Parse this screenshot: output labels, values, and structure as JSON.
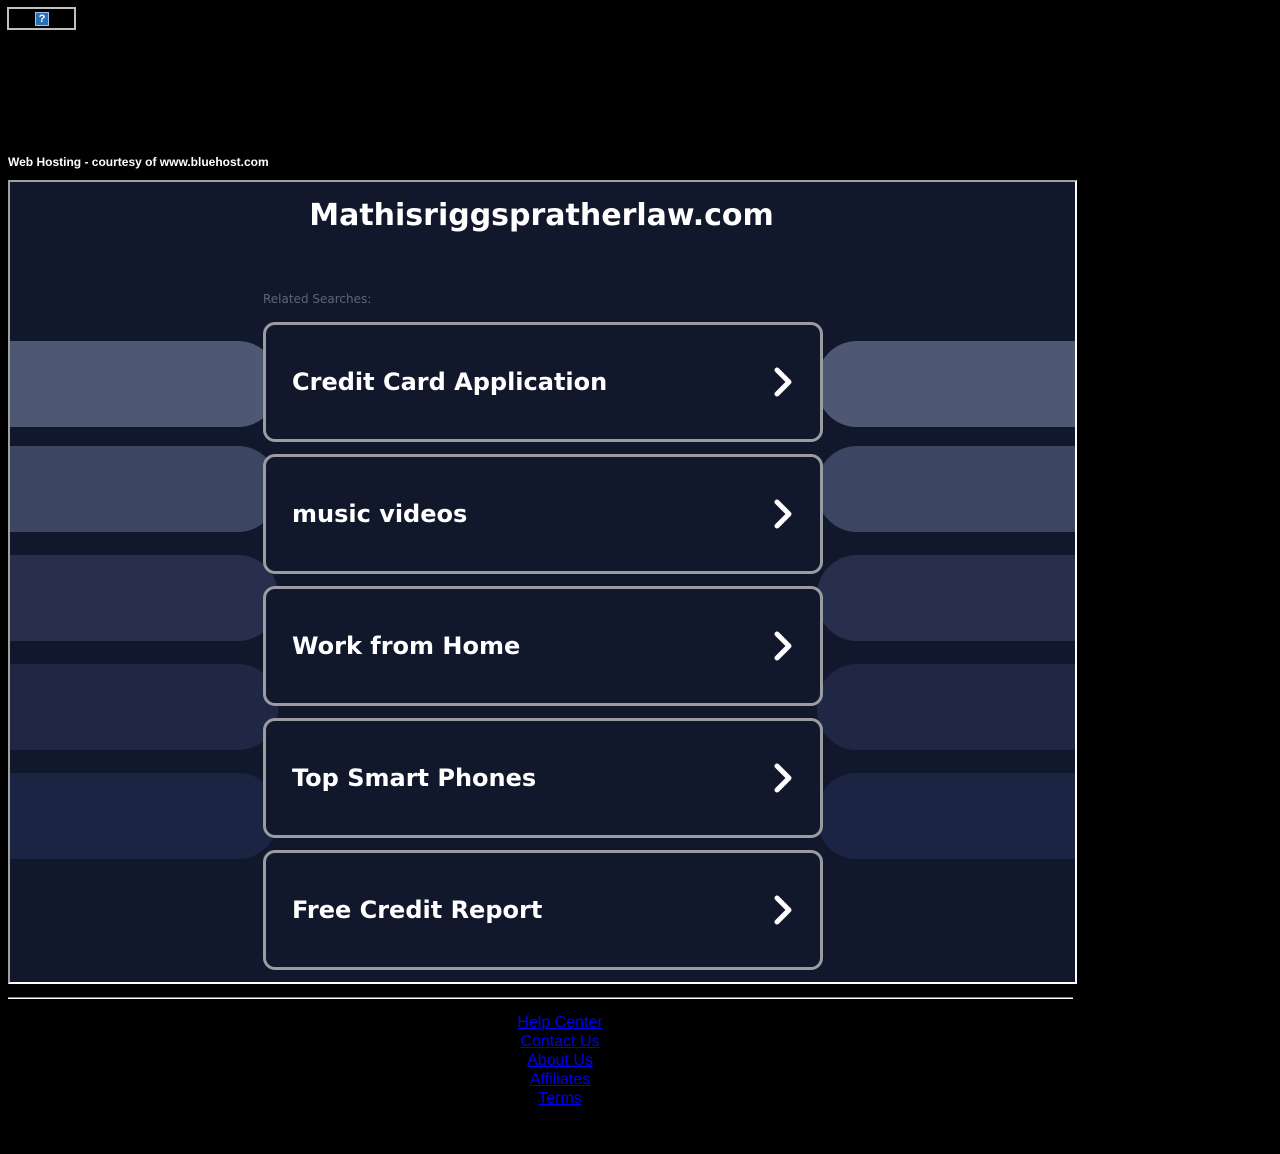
{
  "broken_image": {
    "icon": "broken-image-question-icon",
    "glyph": "?"
  },
  "hosting_credit": "Web Hosting - courtesy of www.bluehost.com",
  "site": {
    "title": "Mathisriggspratherlaw.com",
    "related_label": "Related Searches:"
  },
  "colors": {
    "page_bg": "#000000",
    "frame_bg": "#12182c",
    "card_border": "#9a9ca1",
    "link_color": "#0000ee",
    "deco_bars": [
      "#4e5873",
      "#3c4663",
      "#272f4c",
      "#1f2745",
      "#1b2442"
    ]
  },
  "searches": [
    {
      "label": "Credit Card Application",
      "icon": "chevron-right-icon"
    },
    {
      "label": "music videos",
      "icon": "chevron-right-icon"
    },
    {
      "label": "Work from Home",
      "icon": "chevron-right-icon"
    },
    {
      "label": "Top Smart Phones",
      "icon": "chevron-right-icon"
    },
    {
      "label": "Free Credit Report",
      "icon": "chevron-right-icon"
    }
  ],
  "footer": {
    "links": [
      "Help Center",
      "Contact Us",
      "About Us",
      "Affiliates",
      "Terms"
    ]
  }
}
